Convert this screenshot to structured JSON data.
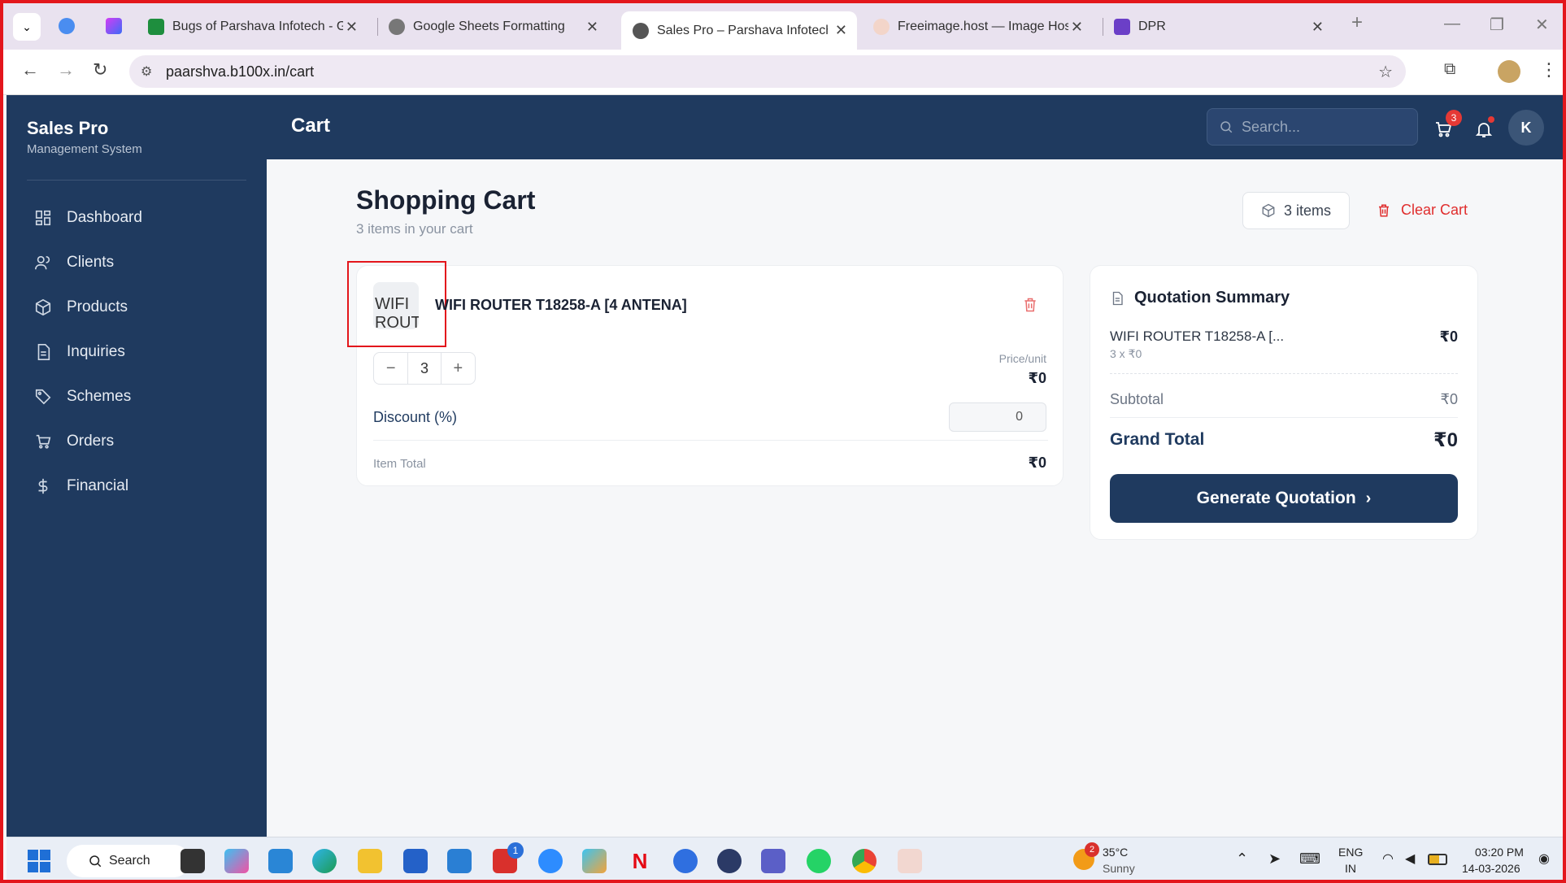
{
  "browser": {
    "tabs": [
      {
        "title": "Bugs of Parshava Infotech - Goo",
        "color": "#1e8e3e"
      },
      {
        "title": "Google Sheets Formatting",
        "color": "#555555"
      },
      {
        "title": "Sales Pro – Parshava Infotech",
        "color": "#555555",
        "active": true
      },
      {
        "title": "Freeimage.host — Image Hosti",
        "color": "#c0795e"
      },
      {
        "title": "DPR",
        "color": "#6b3fc7"
      }
    ],
    "url": "paarshva.b100x.in/cart"
  },
  "app": {
    "brand": {
      "name": "Sales Pro",
      "tagline": "Management System"
    },
    "page_title": "Cart",
    "search_placeholder": "Search...",
    "cart_count": "3",
    "avatar_initial": "K",
    "nav": [
      {
        "label": "Dashboard",
        "icon": "dashboard-icon"
      },
      {
        "label": "Clients",
        "icon": "users-icon"
      },
      {
        "label": "Products",
        "icon": "box-icon"
      },
      {
        "label": "Inquiries",
        "icon": "document-icon"
      },
      {
        "label": "Schemes",
        "icon": "tag-icon"
      },
      {
        "label": "Orders",
        "icon": "cart-icon"
      },
      {
        "label": "Financial",
        "icon": "dollar-icon"
      }
    ]
  },
  "cart": {
    "heading": "Shopping Cart",
    "subheading": "3 items in your cart",
    "items_pill": "3 items",
    "clear_label": "Clear Cart",
    "item": {
      "image_alt": "WIFI ROUT",
      "name": "WIFI ROUTER T18258-A [4 ANTENA]",
      "quantity": "3",
      "price_unit_label": "Price/unit",
      "price_unit": "₹0",
      "discount_label": "Discount (%)",
      "discount_value": "0",
      "item_total_label": "Item Total",
      "item_total": "₹0"
    }
  },
  "summary": {
    "title": "Quotation Summary",
    "line_name": "WIFI ROUTER T18258-A [...",
    "line_sub": "3 x ₹0",
    "line_value": "₹0",
    "subtotal_label": "Subtotal",
    "subtotal_value": "₹0",
    "grand_total_label": "Grand Total",
    "grand_total_value": "₹0",
    "button_label": "Generate Quotation"
  },
  "taskbar": {
    "search_label": "Search",
    "weather_temp": "35°C",
    "weather_desc": "Sunny",
    "weather_badge": "2",
    "outlook_badge": "1",
    "lang_1": "ENG",
    "lang_2": "IN",
    "time": "03:20 PM",
    "date": "14-03-2026"
  }
}
